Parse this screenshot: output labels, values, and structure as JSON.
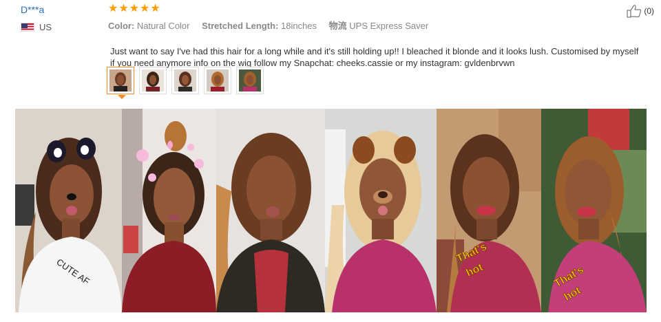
{
  "reviewer": {
    "name": "D***a",
    "country": "US"
  },
  "rating": {
    "stars": 5
  },
  "attributes": [
    {
      "label": "Color:",
      "value": "Natural Color"
    },
    {
      "label": "Stretched Length:",
      "value": "18inches"
    },
    {
      "label": "物流",
      "value": "UPS Express Saver"
    }
  ],
  "review_text": "Just want to say I've had this hair for a long while and it's still holding up!! I bleached it blonde and it looks lush. Customised by myself if you need anymore info on the wig follow my Snapchat: cheeks.cassie or my instagram: gvldenbrvwn",
  "helpful": {
    "count": "(0)"
  },
  "photos": {
    "p1": {
      "shirt_text": "CUTE AF"
    },
    "p5": {
      "sticker_line1": "That's",
      "sticker_line2": "hot"
    },
    "p6": {
      "sticker_line1": "That's",
      "sticker_line2": "hot"
    }
  },
  "colors": {
    "star": "#ff9a00",
    "link": "#2a6ebb",
    "active_thumb": "#f48b2a"
  }
}
